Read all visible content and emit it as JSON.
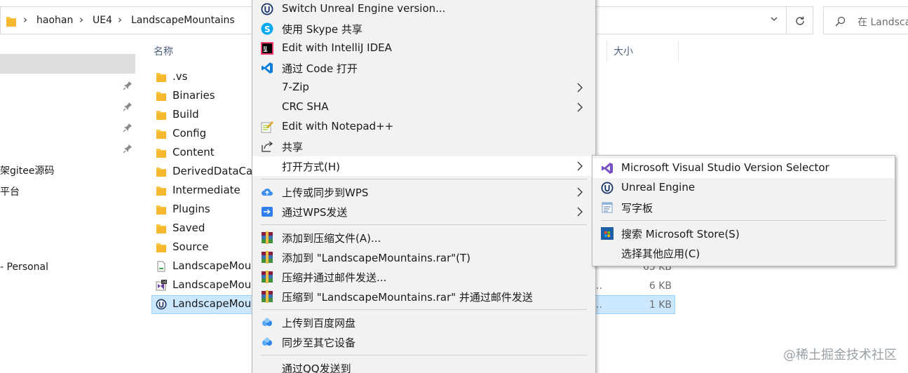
{
  "address_bar": {
    "segments": [
      "haohan",
      "UE4",
      "LandscapeMountains"
    ]
  },
  "search": {
    "placeholder": "在 Landscape"
  },
  "nav": {
    "items": [
      "架gitee源码",
      "平台",
      "- Personal"
    ]
  },
  "columns": {
    "name": "名称",
    "size": "大小"
  },
  "files": [
    {
      "name": ".vs",
      "icon": "folder-icon"
    },
    {
      "name": "Binaries",
      "icon": "folder-icon"
    },
    {
      "name": "Build",
      "icon": "folder-icon"
    },
    {
      "name": "Config",
      "icon": "folder-icon"
    },
    {
      "name": "Content",
      "icon": "folder-icon"
    },
    {
      "name": "DerivedDataCac",
      "icon": "folder-icon"
    },
    {
      "name": "Intermediate",
      "icon": "folder-icon"
    },
    {
      "name": "Plugins",
      "icon": "folder-icon"
    },
    {
      "name": "Saved",
      "icon": "folder-icon"
    },
    {
      "name": "Source",
      "icon": "folder-icon"
    },
    {
      "name": "LandscapeMoun",
      "icon": "file-icon",
      "size": "65 KB"
    },
    {
      "name": "LandscapeMoun",
      "icon": "visual-studio-file-icon",
      "size": "6 KB",
      "dots": ".."
    },
    {
      "name": "LandscapeMoun",
      "icon": "unreal-engine-icon",
      "size": "1 KB",
      "dots": ".."
    }
  ],
  "context_menu": {
    "items": [
      {
        "label": "Switch Unreal Engine version...",
        "icon": "unreal-engine-icon"
      },
      {
        "label": "使用 Skype 共享",
        "icon": "skype-icon"
      },
      {
        "label": "Edit with IntelliJ IDEA",
        "icon": "intellij-icon"
      },
      {
        "label": "通过 Code 打开",
        "icon": "vscode-icon"
      },
      {
        "label": "7-Zip",
        "submenu": true
      },
      {
        "label": "CRC SHA",
        "submenu": true
      },
      {
        "label": "Edit with Notepad++",
        "icon": "notepad-plus-icon"
      },
      {
        "label": "共享",
        "icon": "share-icon"
      },
      {
        "label": "打开方式(H)",
        "submenu": true,
        "highlighted": true
      },
      {
        "label": "上传或同步到WPS",
        "icon": "wps-upload-icon",
        "submenu": true
      },
      {
        "label": "通过WPS发送",
        "icon": "wps-send-icon",
        "submenu": true
      },
      {
        "label": "添加到压缩文件(A)...",
        "icon": "winrar-icon"
      },
      {
        "label": "添加到 \"LandscapeMountains.rar\"(T)",
        "icon": "winrar-icon"
      },
      {
        "label": "压缩并通过邮件发送...",
        "icon": "winrar-icon"
      },
      {
        "label": "压缩到 \"LandscapeMountains.rar\" 并通过邮件发送",
        "icon": "winrar-icon"
      },
      {
        "label": "上传到百度网盘",
        "icon": "baidu-netdisk-icon"
      },
      {
        "label": "同步至其它设备",
        "icon": "baidu-netdisk-icon"
      },
      {
        "label": "通过QQ发送到"
      }
    ]
  },
  "open_with_submenu": {
    "items": [
      {
        "label": "Microsoft Visual Studio Version Selector",
        "icon": "visual-studio-icon",
        "highlighted": true
      },
      {
        "label": "Unreal Engine",
        "icon": "unreal-engine-icon"
      },
      {
        "label": "写字板",
        "icon": "wordpad-icon"
      },
      {
        "label": "搜索 Microsoft Store(S)",
        "icon": "microsoft-store-icon"
      },
      {
        "label": "选择其他应用(C)"
      }
    ]
  },
  "watermark": "@稀土掘金技术社区"
}
